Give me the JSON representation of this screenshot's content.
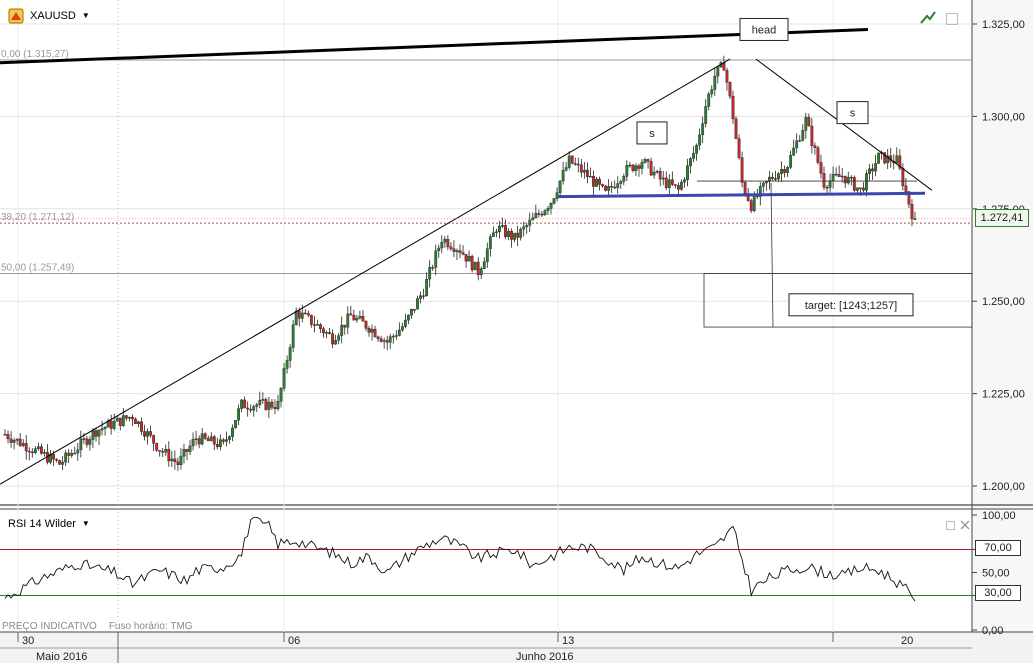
{
  "symbol": "XAUUSD",
  "indicator": {
    "name": "RSI 14 Wilder",
    "levels": [
      70,
      30
    ],
    "level_labels": [
      "70,00",
      "30,00"
    ],
    "axis_labels": [
      "100,00",
      "70,00",
      "50,00",
      "30,00",
      "0,00"
    ]
  },
  "footer": {
    "price_type": "PREÇO INDICATIVO",
    "timezone": "Fuso horário: TMG"
  },
  "colors": {
    "bull": "#2e7d32",
    "bear": "#c62828",
    "trend": "#000000",
    "neckline": "#3949ab",
    "rsi_upper": "#b71c1c",
    "rsi_lower": "#2e7d32"
  },
  "chart_data": {
    "type": "candlestick",
    "title": "XAUUSD",
    "y_axis": {
      "labels": [
        "1.325,00",
        "1.300,00",
        "1.275,00",
        "1.250,00",
        "1.225,00",
        "1.200,00"
      ],
      "values": [
        1325,
        1300,
        1275,
        1250,
        1225,
        1200
      ]
    },
    "x_axis": {
      "ticks": [
        "30",
        "06",
        "13",
        "20"
      ],
      "months": [
        "Maio 2016",
        "Junho 2016"
      ]
    },
    "last_price": {
      "value": 1272.41,
      "label": "1.272,41"
    },
    "fib_levels": [
      {
        "label": "0,00 (1.315,27)",
        "value": 1315.27
      },
      {
        "label": "38,20 (1.271,12)",
        "value": 1271.12
      },
      {
        "label": "50,00 (1.257,49)",
        "value": 1257.49
      }
    ],
    "annotations": [
      {
        "text": "head",
        "value": 1316
      },
      {
        "text": "s",
        "value": 1289
      },
      {
        "text": "s",
        "value": 1296
      },
      {
        "text": "target: [1243;1257]",
        "value": 1250
      }
    ],
    "price_path": [
      [
        0,
        1214
      ],
      [
        6,
        1206
      ],
      [
        10,
        1215
      ],
      [
        14,
        1219
      ],
      [
        17,
        1210
      ],
      [
        19,
        1206
      ],
      [
        21,
        1213
      ],
      [
        24,
        1211
      ],
      [
        26,
        1222
      ],
      [
        28,
        1222
      ],
      [
        30,
        1222
      ],
      [
        32,
        1247
      ],
      [
        34,
        1244
      ],
      [
        36,
        1240
      ],
      [
        38,
        1246
      ],
      [
        40,
        1243
      ],
      [
        42,
        1239
      ],
      [
        44,
        1244
      ],
      [
        46,
        1253
      ],
      [
        48,
        1267
      ],
      [
        50,
        1264
      ],
      [
        52,
        1258
      ],
      [
        54,
        1270
      ],
      [
        56,
        1267
      ],
      [
        58,
        1272
      ],
      [
        60,
        1277
      ],
      [
        62,
        1288
      ],
      [
        64,
        1284
      ],
      [
        66,
        1279
      ],
      [
        68,
        1285
      ],
      [
        70,
        1288
      ],
      [
        72,
        1283
      ],
      [
        74,
        1280
      ],
      [
        76,
        1292
      ],
      [
        77,
        1303
      ],
      [
        78,
        1311
      ],
      [
        79,
        1314
      ],
      [
        80,
        1300
      ],
      [
        81,
        1282
      ],
      [
        82,
        1276
      ],
      [
        84,
        1283
      ],
      [
        86,
        1287
      ],
      [
        88,
        1299
      ],
      [
        90,
        1282
      ],
      [
        92,
        1284
      ],
      [
        94,
        1280
      ],
      [
        96,
        1289
      ],
      [
        98,
        1288
      ],
      [
        100,
        1271
      ]
    ],
    "rsi_path": [
      [
        0,
        28
      ],
      [
        4,
        45
      ],
      [
        8,
        58
      ],
      [
        12,
        50
      ],
      [
        14,
        40
      ],
      [
        17,
        52
      ],
      [
        19,
        46
      ],
      [
        20,
        42
      ],
      [
        21,
        52
      ],
      [
        24,
        55
      ],
      [
        26,
        66
      ],
      [
        27,
        96
      ],
      [
        29,
        90
      ],
      [
        30,
        75
      ],
      [
        32,
        78
      ],
      [
        34,
        72
      ],
      [
        36,
        67
      ],
      [
        38,
        58
      ],
      [
        40,
        64
      ],
      [
        42,
        50
      ],
      [
        44,
        63
      ],
      [
        46,
        73
      ],
      [
        48,
        80
      ],
      [
        50,
        73
      ],
      [
        52,
        62
      ],
      [
        54,
        67
      ],
      [
        56,
        70
      ],
      [
        58,
        56
      ],
      [
        60,
        64
      ],
      [
        62,
        72
      ],
      [
        64,
        72
      ],
      [
        66,
        63
      ],
      [
        68,
        52
      ],
      [
        70,
        64
      ],
      [
        72,
        58
      ],
      [
        74,
        54
      ],
      [
        76,
        66
      ],
      [
        78,
        72
      ],
      [
        80,
        88
      ],
      [
        82,
        35
      ],
      [
        84,
        45
      ],
      [
        86,
        52
      ],
      [
        88,
        55
      ],
      [
        90,
        50
      ],
      [
        92,
        47
      ],
      [
        94,
        54
      ],
      [
        96,
        52
      ],
      [
        98,
        42
      ],
      [
        100,
        28
      ]
    ]
  }
}
